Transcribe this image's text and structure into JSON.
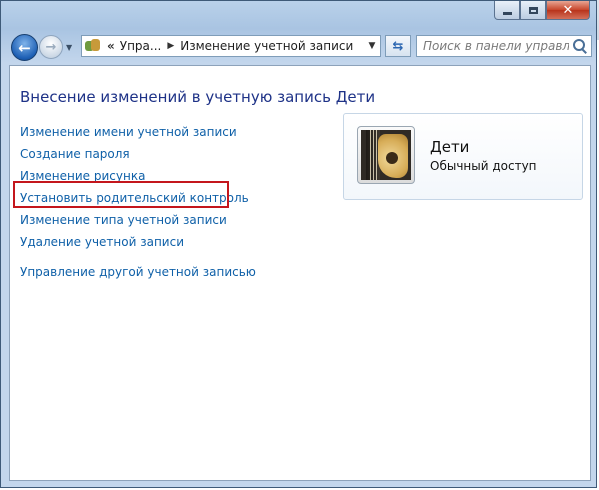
{
  "navigation": {
    "breadcrumb_parent": "Упра...",
    "breadcrumb_current": "Изменение учетной записи"
  },
  "search": {
    "placeholder": "Поиск в панели управле..."
  },
  "main": {
    "heading": "Внесение изменений в учетную запись Дети",
    "links": [
      "Изменение имени учетной записи",
      "Создание пароля",
      "Изменение рисунка",
      "Установить родительский контроль",
      "Изменение типа учетной записи",
      "Удаление учетной записи",
      "Управление другой учетной записью"
    ],
    "highlighted_link_index": 3
  },
  "account": {
    "name": "Дети",
    "type": "Обычный доступ"
  },
  "colors": {
    "link": "#0f60a8",
    "heading": "#1e3287",
    "highlight_border": "#c4161c"
  }
}
